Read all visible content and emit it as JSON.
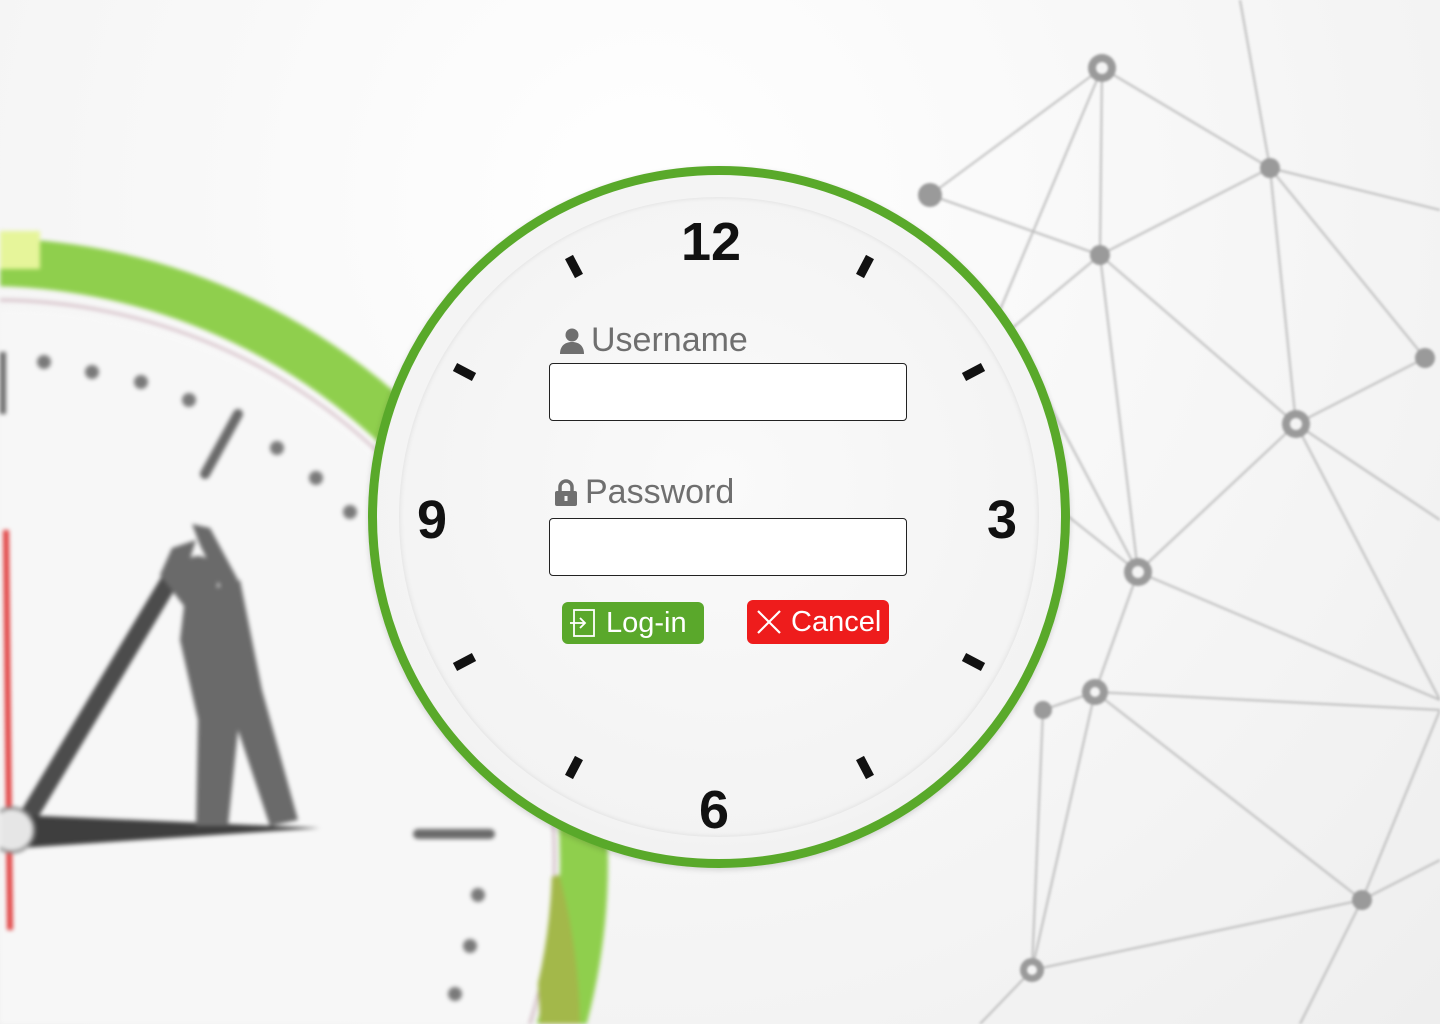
{
  "form": {
    "username_label": "Username",
    "username_value": "",
    "password_label": "Password",
    "password_value": "",
    "login_label": "Log-in",
    "cancel_label": "Cancel"
  },
  "clock": {
    "numerals": {
      "twelve": "12",
      "three": "3",
      "six": "6",
      "nine": "9"
    }
  },
  "icons": {
    "username": "user-icon",
    "password": "lock-icon",
    "login": "login-icon",
    "cancel": "close-icon"
  },
  "colors": {
    "accent_green": "#59a92a",
    "login_button": "#5aa82b",
    "cancel_button": "#ee1c1c",
    "label_text": "#6f6f6f"
  }
}
